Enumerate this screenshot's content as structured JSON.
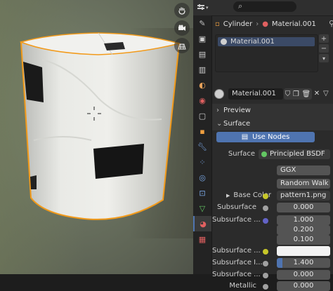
{
  "properties": {
    "search_placeholder": "⌕",
    "breadcrumb": {
      "object": "Cylinder",
      "separator": "›",
      "material": "Material.001"
    },
    "slot_list": [
      "Material.001"
    ],
    "material_field": "Material.001",
    "panels": {
      "preview": "Preview",
      "surface": "Surface"
    },
    "use_nodes_label": "Use Nodes",
    "surface": {
      "label": "Surface",
      "value": "Principled BSDF"
    },
    "distribution": "GGX",
    "subsurface_method": "Random Walk",
    "base_color": {
      "label": "Base Color",
      "value": "pattern1.png"
    },
    "subsurface": {
      "label": "Subsurface",
      "value": "0.000"
    },
    "subsurface_radius": {
      "label": "Subsurface ...",
      "values": [
        "1.000",
        "0.200",
        "0.100"
      ]
    },
    "subsurface_color": {
      "label": "Subsurface ..."
    },
    "subsurface_ior": {
      "label": "Subsurface I...",
      "value": "1.400",
      "level": 0.1
    },
    "subsurface_aniso": {
      "label": "Subsurface ...",
      "value": "0.000"
    },
    "metallic": {
      "label": "Metallic",
      "value": "0.000"
    }
  },
  "colors": {
    "accent": "#4f74b0",
    "socket_yellow": "#c7c729",
    "socket_purple": "#6363c7",
    "socket_gray": "#a1a1a1",
    "socket_green": "#63c763"
  },
  "icons": [
    "hand-icon",
    "camera-icon",
    "grid-icon",
    "search-icon",
    "cube-icon",
    "material-icon",
    "pin-icon",
    "wrench-icon",
    "particles-icon",
    "physics-icon",
    "constraint-icon",
    "data-icon",
    "texture-icon"
  ]
}
